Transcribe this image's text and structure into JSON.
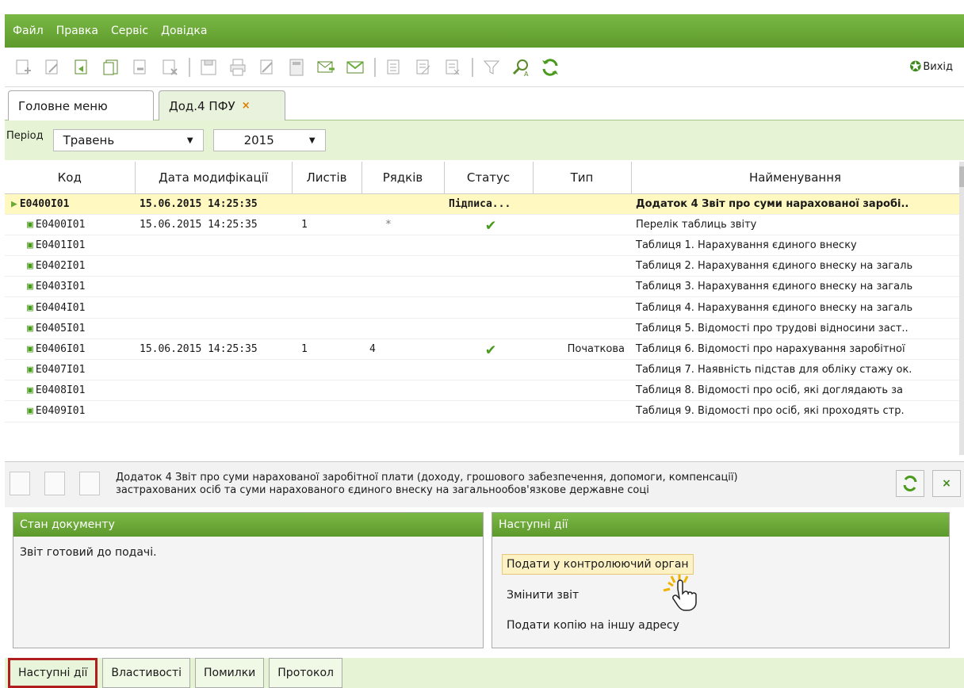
{
  "menu": [
    "Файл",
    "Правка",
    "Сервіс",
    "Довідка"
  ],
  "toolbar": {
    "exit_label": "Вихід"
  },
  "tabs": [
    {
      "label": "Головне меню"
    },
    {
      "label": "Дод.4 ПФУ",
      "close": "×"
    }
  ],
  "filter": {
    "period_label": "Період",
    "month": "Травень",
    "year": "2015"
  },
  "table": {
    "headers": [
      "Код",
      "Дата модифікації",
      "Листів",
      "Рядків",
      "Статус",
      "Тип",
      "Найменування"
    ],
    "rows": [
      {
        "code": "E0400I01",
        "date": "15.06.2015 14:25:35",
        "sheets": "",
        "lines": "",
        "status": "Підписа...",
        "type": "",
        "name": "Додаток 4 Звіт про суми нарахованої заробі..",
        "parent": true
      },
      {
        "code": "E0400I01",
        "date": "15.06.2015 14:25:35",
        "sheets": "1",
        "lines": "*",
        "status": "check",
        "type": "",
        "name": "Перелік таблиць звіту"
      },
      {
        "code": "E0401I01",
        "date": "",
        "sheets": "",
        "lines": "",
        "status": "",
        "type": "",
        "name": "Таблиця 1. Нарахування єдиного внеску"
      },
      {
        "code": "E0402I01",
        "date": "",
        "sheets": "",
        "lines": "",
        "status": "",
        "type": "",
        "name": "Таблиця 2. Нарахування єдиного внеску на загаль"
      },
      {
        "code": "E0403I01",
        "date": "",
        "sheets": "",
        "lines": "",
        "status": "",
        "type": "",
        "name": "Таблиця 3. Нарахування єдиного внеску на загаль"
      },
      {
        "code": "E0404I01",
        "date": "",
        "sheets": "",
        "lines": "",
        "status": "",
        "type": "",
        "name": "Таблиця 4. Нарахування єдиного внеску на загаль"
      },
      {
        "code": "E0405I01",
        "date": "",
        "sheets": "",
        "lines": "",
        "status": "",
        "type": "",
        "name": "Таблиця 5. Відомості про трудові відносини заст.."
      },
      {
        "code": "E0406I01",
        "date": "15.06.2015 14:25:35",
        "sheets": "1",
        "lines": "4",
        "status": "check",
        "type": "Початкова",
        "name": "Таблиця 6. Відомості про нарахування заробітної"
      },
      {
        "code": "E0407I01",
        "date": "",
        "sheets": "",
        "lines": "",
        "status": "",
        "type": "",
        "name": "Таблиця 7. Наявність підстав для обліку стажу ок."
      },
      {
        "code": "E0408I01",
        "date": "",
        "sheets": "",
        "lines": "",
        "status": "",
        "type": "",
        "name": "Таблиця 8. Відомості про осіб, які доглядають за"
      },
      {
        "code": "E0409I01",
        "date": "",
        "sheets": "",
        "lines": "",
        "status": "",
        "type": "",
        "name": "Таблиця 9. Відомості про осіб, які проходять стр."
      }
    ]
  },
  "detail": {
    "line1": "Додаток 4 Звіт про суми нарахованої заробітної плати (доходу, грошового забезпечення, допомоги, компенсації)",
    "line2": "застрахованих осіб та суми нарахованого єдиного внеску на загальнообов'язкове державне соці"
  },
  "status_panel": {
    "title": "Стан документу",
    "text": "Звіт готовий до подачі."
  },
  "actions_panel": {
    "title": "Наступні дії",
    "items": [
      "Подати у контролюючий орган",
      "Змінити звіт",
      "Подати копію на іншу адресу"
    ]
  },
  "bottom_tabs": [
    "Наступні дії",
    "Властивості",
    "Помилки",
    "Протокол"
  ],
  "colors": {
    "accent": "#6aab38",
    "highlight_row": "#fff8c0",
    "check": "#4a9a1e",
    "active_tab_border": "#b01e1e"
  }
}
